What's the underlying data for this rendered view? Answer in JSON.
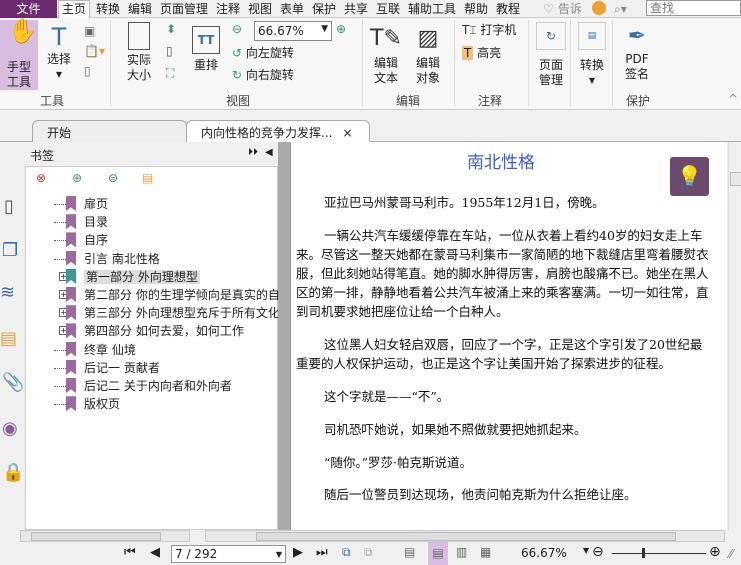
{
  "menu": {
    "file": "文件",
    "items": [
      "主页",
      "转换",
      "编辑",
      "页面管理",
      "注释",
      "视图",
      "表单",
      "保护",
      "共享",
      "互联",
      "辅助工具",
      "帮助",
      "教程"
    ],
    "tell": "告诉",
    "search_placeholder": "查找"
  },
  "ribbon": {
    "hand": "手型\n工具",
    "select": "选择",
    "actual": "实际\n大小",
    "reflow": "重排",
    "zoom": "66.67%",
    "rotate_left": "向左旋转",
    "rotate_right": "向右旋转",
    "edit_text": "编辑\n文本",
    "edit_object": "编辑\n对象",
    "typewriter": "打字机",
    "highlight": "高亮",
    "page_mgmt": "页面\n管理",
    "convert": "转换",
    "pdf_sign": "PDF\n签名",
    "groups": {
      "tools": "工具",
      "view": "视图",
      "edit": "编辑",
      "comment": "注释",
      "protect": "保护"
    }
  },
  "tabs": {
    "start": "开始",
    "doc": "内向性格的竞争力发挥..."
  },
  "sidebar": {
    "title": "书签",
    "bookmarks": [
      {
        "label": "扉页",
        "expand": false
      },
      {
        "label": "目录",
        "expand": false
      },
      {
        "label": "自序",
        "expand": false
      },
      {
        "label": "引言 南北性格",
        "expand": false
      },
      {
        "label": "第一部分 外向理想型",
        "expand": true,
        "selected": true
      },
      {
        "label": "第二部分 你的生理学倾向是真实的自己",
        "expand": true
      },
      {
        "label": "第三部分 外向理想型充斥于所有文化传",
        "expand": true
      },
      {
        "label": "第四部分 如何去爱，如何工作",
        "expand": true
      },
      {
        "label": "终章 仙境",
        "expand": false
      },
      {
        "label": "后记一 贡献者",
        "expand": false
      },
      {
        "label": "后记二 关于内向者和外向者",
        "expand": false
      },
      {
        "label": "版权页",
        "expand": false
      }
    ]
  },
  "document": {
    "title": "南北性格",
    "paragraphs": [
      "亚拉巴马州蒙哥马利市。1955年12月1日，傍晚。",
      "一辆公共汽车缓缓停靠在车站，一位从衣着上看约40岁的妇女走上车来。尽管这一整天她都在蒙哥马利集市一家简陋的地下裁缝店里弯着腰熨衣服，但此刻她站得笔直。她的脚水肿得厉害，肩膀也酸痛不已。她坐在黑人区的第一排，静静地看着公共汽车被涌上来的乘客塞满。一切一如往常，直到司机要求她把座位让给一个白种人。",
      "这位黑人妇女轻启双唇，回应了一个字，正是这个字引发了20世纪最重要的人权保护运动，也正是这个字让美国开始了探索进步的征程。",
      "这个字就是——“不”。",
      "司机恐吓她说，如果她不照做就要把她抓起来。",
      "“随你。”罗莎·帕克斯说道。",
      "随后一位警员到达现场，他责问帕克斯为什么拒绝让座。"
    ]
  },
  "status": {
    "page": "7 / 292",
    "zoom": "66.67%"
  },
  "colors": {
    "accent": "#6b2b6e",
    "title": "#3b5bdb",
    "bookmark": "#9b6a9e",
    "bookmark_selected": "#3a9b94"
  }
}
